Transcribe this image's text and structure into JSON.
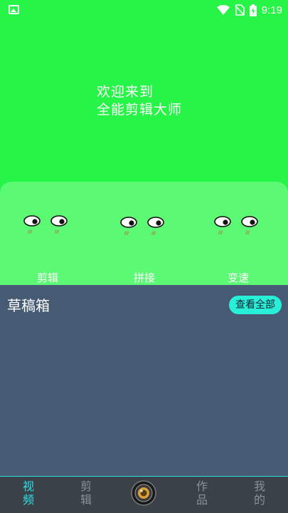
{
  "status_bar": {
    "time": "9:19",
    "icons": [
      "image-icon",
      "wifi-icon",
      "no-sim-icon",
      "battery-charging-icon"
    ]
  },
  "hero": {
    "line1": "欢迎来到",
    "line2": "全能剪辑大师"
  },
  "features": [
    {
      "label": "剪辑",
      "icon": "cartoon-eyes-icon"
    },
    {
      "label": "拼接",
      "icon": "cartoon-eyes-icon"
    },
    {
      "label": "变速",
      "icon": "cartoon-eyes-icon"
    }
  ],
  "drafts": {
    "title": "草稿箱",
    "view_all_label": "查看全部"
  },
  "bottom_nav": {
    "items": [
      {
        "label": "视频",
        "c1": "视",
        "c2": "频",
        "active": true
      },
      {
        "label": "剪辑",
        "c1": "剪",
        "c2": "辑",
        "active": false
      },
      {
        "label": "作品",
        "c1": "作",
        "c2": "品",
        "active": false
      },
      {
        "label": "我的",
        "c1": "我",
        "c2": "的",
        "active": false
      }
    ],
    "center_icon": "camera-lens-icon"
  },
  "colors": {
    "background": "#26f548",
    "feature_panel": "#5cfa74",
    "drafts_bg": "#475a73",
    "accent": "#2de0e6",
    "view_all_bg": "#28f0d8",
    "nav_bg": "#3b4148"
  }
}
